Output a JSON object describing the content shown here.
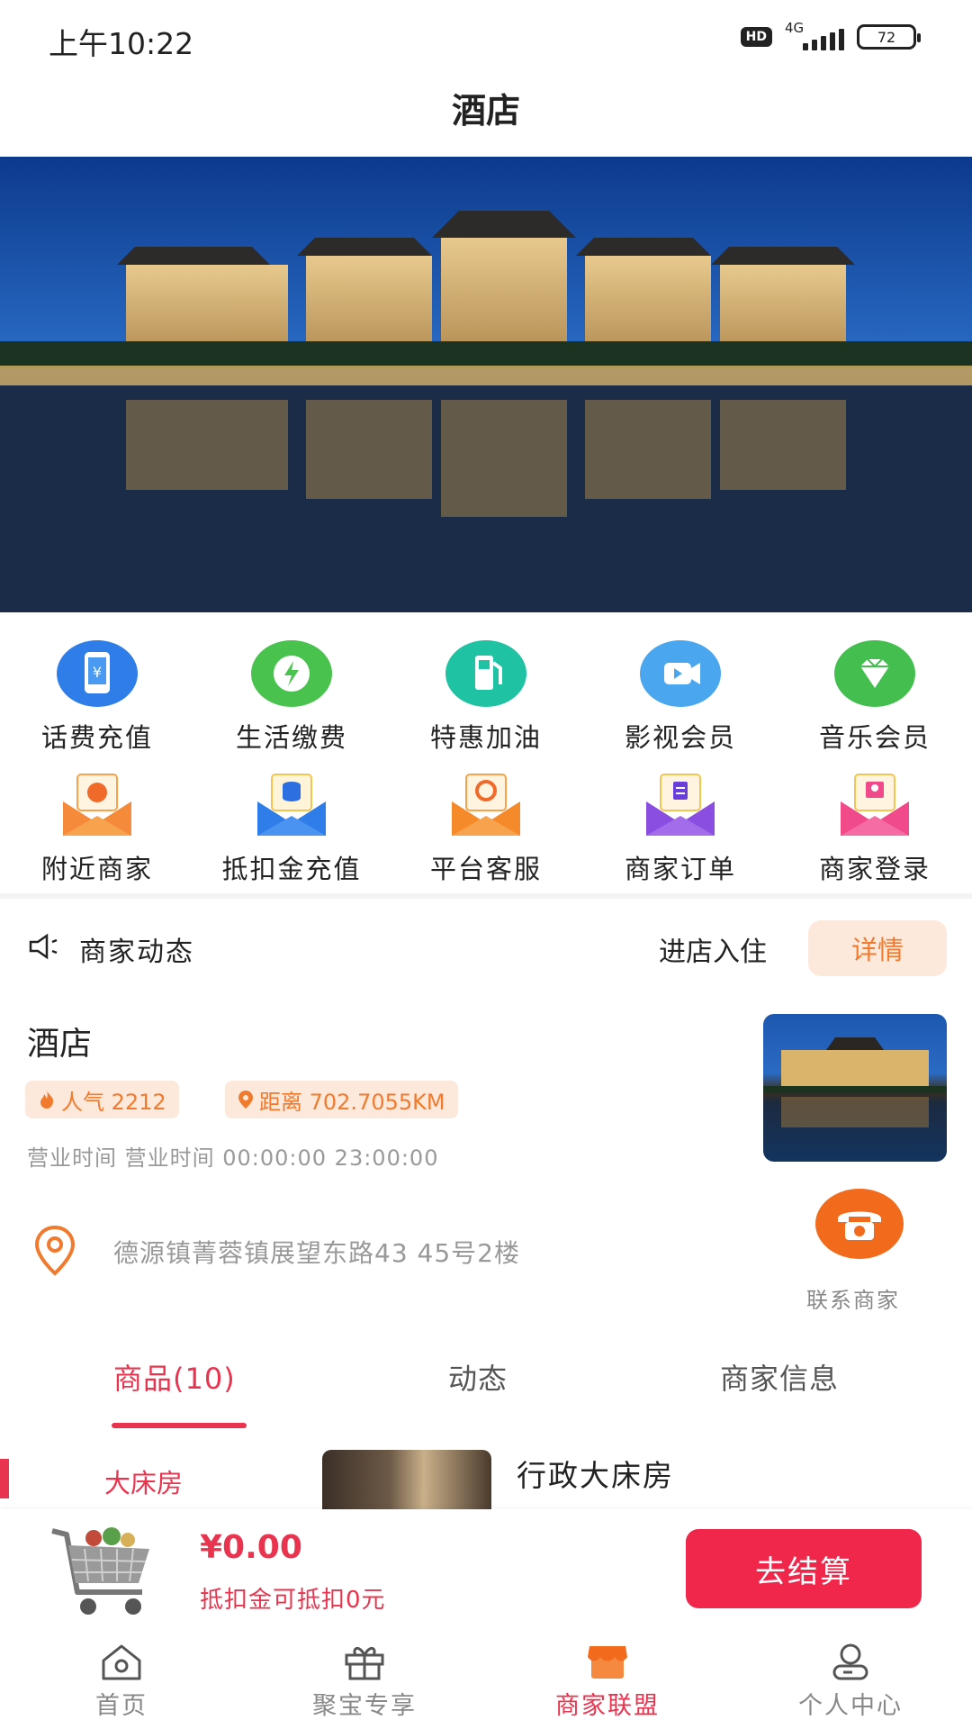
{
  "status_bar": {
    "time": "上午10:22",
    "hd": "HD",
    "network": "4G",
    "battery": "72"
  },
  "header": {
    "title": "酒店"
  },
  "quick_actions": [
    {
      "label": "话费充值",
      "icon": "phone-recharge-icon"
    },
    {
      "label": "生活缴费",
      "icon": "utility-payment-icon"
    },
    {
      "label": "特惠加油",
      "icon": "fuel-pump-icon"
    },
    {
      "label": "影视会员",
      "icon": "video-camera-icon"
    },
    {
      "label": "音乐会员",
      "icon": "diamond-icon"
    },
    {
      "label": "附近商家",
      "icon": "nearby-shops-envelope-icon"
    },
    {
      "label": "抵扣金充值",
      "icon": "coin-stack-envelope-icon"
    },
    {
      "label": "平台客服",
      "icon": "customer-service-envelope-icon"
    },
    {
      "label": "商家订单",
      "icon": "order-list-envelope-icon"
    },
    {
      "label": "商家登录",
      "icon": "merchant-login-envelope-icon"
    }
  ],
  "news": {
    "label": "商家动态",
    "ticker": "进店入住",
    "details_label": "详情"
  },
  "shop": {
    "name": "酒店",
    "popularity": "人气 2212",
    "distance": "距离 702.7055KM",
    "hours": "营业时间 营业时间 00:00:00 23:00:00",
    "address": "德源镇菁蓉镇展望东路43 45号2楼",
    "contact_label": "联系商家"
  },
  "tabs": [
    {
      "label": "商品(10)",
      "active": true
    },
    {
      "label": "动态",
      "active": false
    },
    {
      "label": "商家信息",
      "active": false
    }
  ],
  "products": {
    "category": "大床房",
    "first_title": "行政大床房"
  },
  "cart": {
    "price": "¥0.00",
    "deduct_note": "抵扣金可抵扣0元",
    "checkout_label": "去结算"
  },
  "bottom_nav": [
    {
      "label": "首页",
      "icon": "home-icon",
      "active": false
    },
    {
      "label": "聚宝专享",
      "icon": "gift-icon",
      "active": false
    },
    {
      "label": "商家联盟",
      "icon": "store-icon",
      "active": true
    },
    {
      "label": "个人中心",
      "icon": "profile-icon",
      "active": false
    }
  ],
  "colors": {
    "accent": "#e8344e",
    "orange": "#f07a2e",
    "tag_bg": "#fde9dc",
    "call_orange": "#f26b1d"
  }
}
